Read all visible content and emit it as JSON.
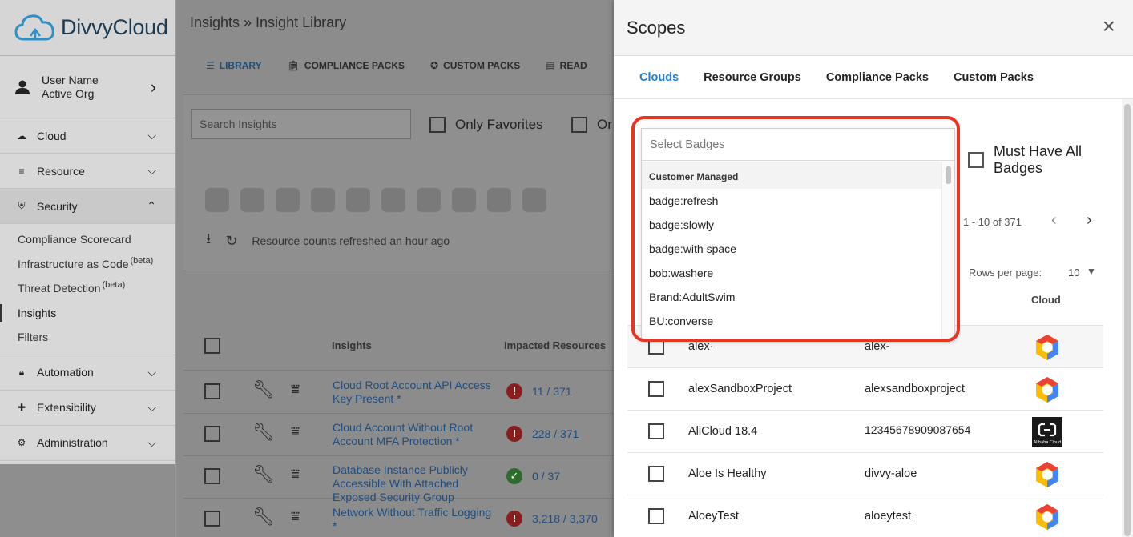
{
  "brand": {
    "name": "DivvyCloud"
  },
  "user": {
    "name": "User Name",
    "org": "Active Org"
  },
  "sidebar": {
    "items": [
      {
        "label": "Cloud"
      },
      {
        "label": "Resource"
      },
      {
        "label": "Security"
      },
      {
        "label": "Automation"
      },
      {
        "label": "Extensibility"
      },
      {
        "label": "Administration"
      }
    ],
    "security_sub": [
      {
        "label": "Compliance Scorecard",
        "sup": ""
      },
      {
        "label": "Infrastructure as Code",
        "sup": "(beta)"
      },
      {
        "label": "Threat Detection",
        "sup": "(beta)"
      },
      {
        "label": "Insights",
        "sup": ""
      },
      {
        "label": "Filters",
        "sup": ""
      }
    ]
  },
  "main": {
    "breadcrumb": "Insights » Insight Library",
    "tabs": [
      "LIBRARY",
      "COMPLIANCE PACKS",
      "CUSTOM PACKS",
      "READ"
    ],
    "search_placeholder": "Search Insights",
    "only_favorites": "Only Favorites",
    "second_filter": "Or",
    "refresh_text": "Resource counts refreshed an hour ago",
    "columns": {
      "insights": "Insights",
      "impacted": "Impacted Resources"
    },
    "rows": [
      {
        "name": "Cloud Root Account API Access Key Present *",
        "impacted": "11 / 371",
        "status": "bad"
      },
      {
        "name": "Cloud Account Without Root Account MFA Protection *",
        "impacted": "228 / 371",
        "status": "bad"
      },
      {
        "name": "Database Instance Publicly Accessible With Attached Exposed Security Group",
        "impacted": "0 / 37",
        "status": "ok"
      },
      {
        "name": "Network Without Traffic Logging *",
        "impacted": "3,218 / 3,370",
        "status": "bad"
      }
    ]
  },
  "scopes": {
    "title": "Scopes",
    "close_icon": "×",
    "tabs": [
      "Clouds",
      "Resource Groups",
      "Compliance Packs",
      "Custom Packs"
    ],
    "badge_placeholder": "Select Badges",
    "must_have_all": "Must Have All Badges",
    "pager": "1 - 10 of 371",
    "rows_per_page_label": "Rows per page:",
    "rows_per_page": "10",
    "cloud_col": "Cloud",
    "dropdown": {
      "group": "Customer Managed",
      "options": [
        "badge:refresh",
        "badge:slowly",
        "badge:with space",
        "bob:washere",
        "Brand:AdultSwim",
        "BU:converse"
      ]
    },
    "rows": [
      {
        "name": "alex·",
        "id": "alex-",
        "cloud": "gcp"
      },
      {
        "name": "alexSandboxProject",
        "id": "alexsandboxproject",
        "cloud": "gcp"
      },
      {
        "name": "AliCloud 18.4",
        "id": "12345678909087654",
        "cloud": "alibaba"
      },
      {
        "name": "Aloe Is Healthy",
        "id": "divvy-aloe",
        "cloud": "gcp"
      },
      {
        "name": "AloeyTest",
        "id": "aloeytest",
        "cloud": "gcp"
      }
    ],
    "alibaba_logo_text": "Alibaba Cloud"
  },
  "colors": {
    "accent": "#1f7fd1",
    "highlight": "#ea3322",
    "link": "#1f4d80"
  }
}
